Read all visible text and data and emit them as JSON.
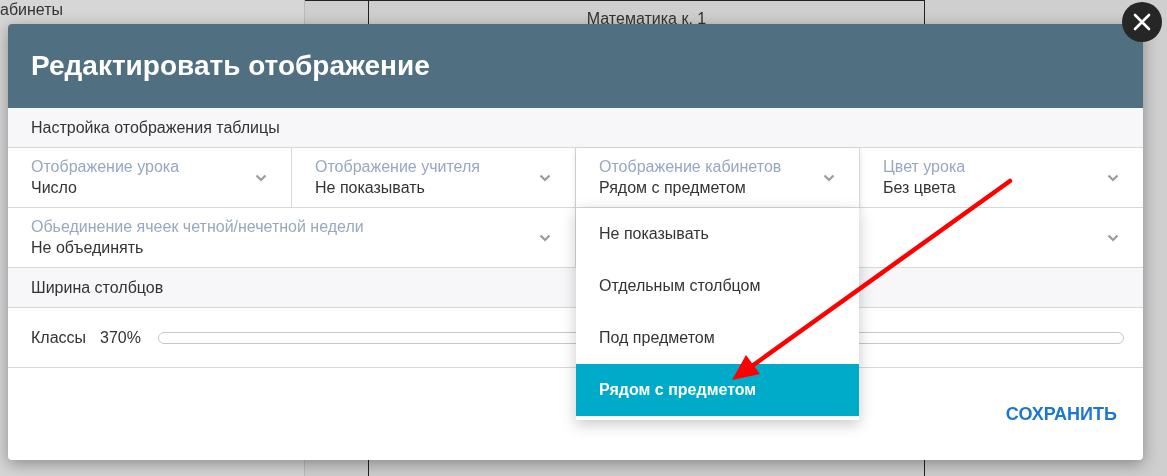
{
  "background": {
    "column_1": "абинеты",
    "column_3": "Математика к. 1"
  },
  "dialog": {
    "title": "Редактировать отображение",
    "sections": [
      {
        "kind": "heading",
        "text": "Настройка отображения таблицы"
      },
      {
        "kind": "selects",
        "items": [
          {
            "label": "Отображение урока",
            "value": "Число",
            "wide": false,
            "open": false
          },
          {
            "label": "Отображение учителя",
            "value": "Не показывать",
            "wide": false,
            "open": false
          },
          {
            "label": "Отображение кабинетов",
            "value": "Рядом с предметом",
            "wide": false,
            "open": true,
            "options": [
              {
                "text": "Не показывать",
                "selected": false
              },
              {
                "text": "Отдельным столбцом",
                "selected": false
              },
              {
                "text": "Под предметом",
                "selected": false
              },
              {
                "text": "Рядом с предметом",
                "selected": true
              }
            ]
          },
          {
            "label": "Цвет урока",
            "value": "Без цвета",
            "wide": false,
            "open": false
          },
          {
            "label": "Обьединение ячеек четной/нечетной недели",
            "value": "Не объединять",
            "wide": true,
            "open": false
          },
          {
            "wide": true,
            "open": false
          }
        ]
      },
      {
        "kind": "heading",
        "text": "Ширина столбцов"
      },
      {
        "kind": "slider",
        "label": "Классы",
        "reading": "370%"
      }
    ],
    "save_button": "СОХРАНИТЬ"
  }
}
